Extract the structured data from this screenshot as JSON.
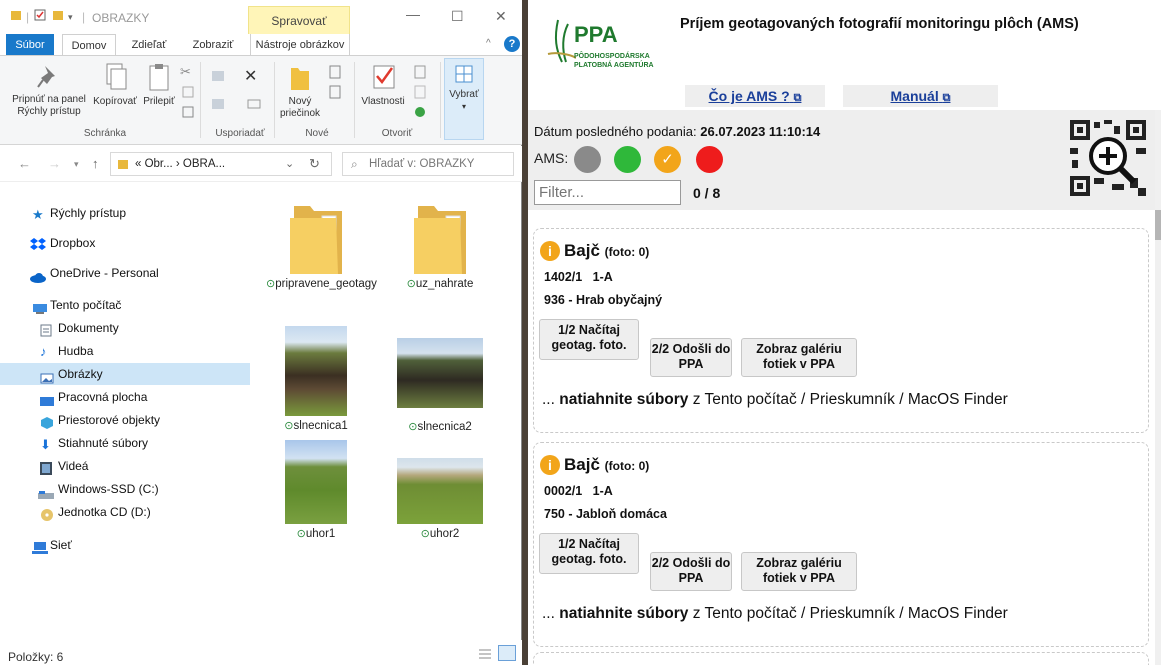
{
  "explorer": {
    "title": "OBRAZKY",
    "context_tab_header": "Spravovať",
    "tabs": [
      "Súbor",
      "Domov",
      "Zdieľať",
      "Zobraziť",
      "Nástroje obrázkov"
    ],
    "ribbon": {
      "pin_label": "Pripnúť na panel Rýchly prístup",
      "copy_label": "Kopírovať",
      "paste_label": "Prilepiť",
      "new_folder_label": "Nový priečinok",
      "properties_label": "Vlastnosti",
      "select_label": "Vybrať",
      "groups": [
        "Schránka",
        "Usporiadať",
        "Nové",
        "Otvoriť"
      ]
    },
    "address": {
      "path": "« Obr... › OBRA...",
      "search_placeholder": "Hľadať v: OBRAZKY"
    },
    "nav": [
      {
        "label": "Rýchly prístup",
        "icon": "star-icon"
      },
      {
        "label": "Dropbox",
        "icon": "dropbox-icon"
      },
      {
        "label": "OneDrive - Personal",
        "icon": "cloud-icon"
      },
      {
        "label": "Tento počítač",
        "icon": "computer-icon"
      },
      {
        "label": "Dokumenty",
        "icon": "documents-icon"
      },
      {
        "label": "Hudba",
        "icon": "music-icon"
      },
      {
        "label": "Obrázky",
        "icon": "pictures-icon"
      },
      {
        "label": "Pracovná plocha",
        "icon": "desktop-icon"
      },
      {
        "label": "Priestorové objekty",
        "icon": "3d-objects-icon"
      },
      {
        "label": "Stiahnuté súbory",
        "icon": "download-icon"
      },
      {
        "label": "Videá",
        "icon": "videos-icon"
      },
      {
        "label": "Windows-SSD (C:)",
        "icon": "drive-icon"
      },
      {
        "label": "Jednotka CD (D:)",
        "icon": "cd-drive-icon"
      },
      {
        "label": "Sieť",
        "icon": "network-icon"
      }
    ],
    "files": [
      {
        "name": "pripravene_geotagy",
        "type": "folder"
      },
      {
        "name": "uz_nahrate",
        "type": "folder"
      },
      {
        "name": "slnecnica1",
        "type": "image"
      },
      {
        "name": "slnecnica2",
        "type": "image"
      },
      {
        "name": "uhor1",
        "type": "image"
      },
      {
        "name": "uhor2",
        "type": "image"
      }
    ],
    "status": "Položky: 6"
  },
  "ams": {
    "logo": "PPA",
    "logo_sub_1": "PÔDOHOSPODÁRSKA",
    "logo_sub_2": "PLATOBNÁ AGENTÚRA",
    "title": "Príjem geotagovaných fotografií monitoringu plôch (AMS)",
    "link_what": "Čo je AMS ?",
    "link_manual": "Manuál",
    "last_sub_label": "Dátum posledného podania:",
    "last_sub_value": "26.07.2023 11:10:14",
    "ams_label": "AMS:",
    "status_colors": [
      "#8a8a8a",
      "#2fb83a",
      "#f2a51a",
      "#ee1c1c"
    ],
    "filter_placeholder": "Filter...",
    "count": "0 / 8",
    "cards": [
      {
        "name": "Bajč",
        "photos": "(foto: 0)",
        "parcel": "1402/1",
        "code": "1-A",
        "crop_code": "936",
        "crop": "Hrab obyčajný",
        "btn1": "1/2 Načítaj geotag. foto.",
        "btn2": "2/2 Odošli do PPA",
        "btn3": "Zobraz galériu fotiek v PPA",
        "drag_pre": "...",
        "drag_bold": "natiahnite súbory",
        "drag_post": "z Tento počítač / Prieskumník / MacOS Finder"
      },
      {
        "name": "Bajč",
        "photos": "(foto: 0)",
        "parcel": "0002/1",
        "code": "1-A",
        "crop_code": "750",
        "crop": "Jabloň domáca",
        "btn1": "1/2 Načítaj geotag. foto.",
        "btn2": "2/2 Odošli do PPA",
        "btn3": "Zobraz galériu fotiek v PPA",
        "drag_pre": "...",
        "drag_bold": "natiahnite súbory",
        "drag_post": "z Tento počítač / Prieskumník / MacOS Finder"
      }
    ]
  }
}
